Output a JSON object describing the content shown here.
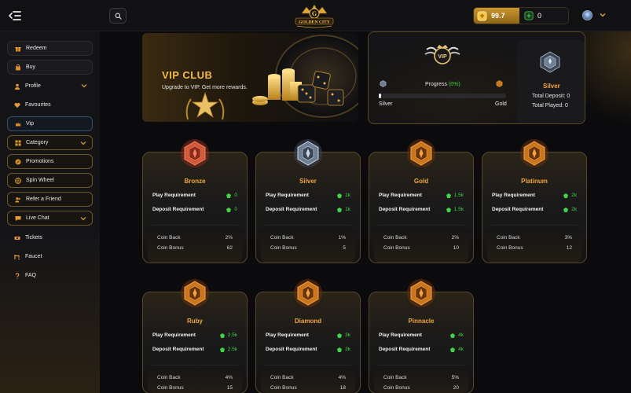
{
  "header": {
    "logo_text": "GOLDEN CITY",
    "wallet": {
      "gold_value": "99.7",
      "green_value": "0"
    },
    "icons": {
      "menu": "menu-arrow-icon",
      "search": "search-icon",
      "gold": "gold-coin-icon",
      "green": "green-coin-icon",
      "avatar": "avatar",
      "chevron": "chevron-down-icon"
    }
  },
  "sidebar": {
    "items": [
      {
        "label": "Redeem",
        "icon": "gift-icon"
      },
      {
        "label": "Buy",
        "icon": "shopping-bag-icon"
      },
      {
        "label": "Profile",
        "icon": "user-icon"
      },
      {
        "label": "Favourites",
        "icon": "heart-icon"
      },
      {
        "label": "Vip",
        "icon": "crown-icon"
      },
      {
        "label": "Category",
        "icon": "grid-icon"
      },
      {
        "label": "Promotions",
        "icon": "percent-icon"
      },
      {
        "label": "Spin Wheel",
        "icon": "wheel-icon"
      },
      {
        "label": "Refer a Friend",
        "icon": "users-icon"
      },
      {
        "label": "Live Chat",
        "icon": "chat-icon"
      },
      {
        "label": "Tickets",
        "icon": "ticket-icon"
      },
      {
        "label": "Faucet",
        "icon": "faucet-icon"
      },
      {
        "label": "FAQ",
        "icon": "question-icon"
      }
    ]
  },
  "banner": {
    "title": "VIP CLUB",
    "subtitle": "Upgrade to VIP. Get more rewards."
  },
  "progress": {
    "label": "Progress",
    "percent_text": "(0%)",
    "percent": 0.02,
    "from_level": "Silver",
    "to_level": "Gold",
    "current_tier": "Silver",
    "total_deposit": "Total Deposit:  0",
    "total_played": "Total Played:  0"
  },
  "colors": {
    "accent": "#f0a53a",
    "green": "#3fd447",
    "card_border": "#5a4628"
  },
  "labels": {
    "play_req": "Play Requirement",
    "deposit_req": "Deposit Requirement",
    "coin_back": "Coin Back",
    "coin_bonus": "Coin Bonus"
  },
  "tiers": [
    {
      "name": "Bronze",
      "play": "0",
      "deposit": "0",
      "coin_back": "2%",
      "coin_bonus": "62"
    },
    {
      "name": "Silver",
      "play": "1k",
      "deposit": "1k",
      "coin_back": "1%",
      "coin_bonus": "5"
    },
    {
      "name": "Gold",
      "play": "1.5k",
      "deposit": "1.5k",
      "coin_back": "2%",
      "coin_bonus": "10"
    },
    {
      "name": "Platinum",
      "play": "2k",
      "deposit": "2k",
      "coin_back": "3%",
      "coin_bonus": "12"
    },
    {
      "name": "Ruby",
      "play": "2.5k",
      "deposit": "2.5k",
      "coin_back": "4%",
      "coin_bonus": "15"
    },
    {
      "name": "Diamond",
      "play": "3k",
      "deposit": "3k",
      "coin_back": "4%",
      "coin_bonus": "18"
    },
    {
      "name": "Pinnacle",
      "play": "4k",
      "deposit": "4k",
      "coin_back": "5%",
      "coin_bonus": "20"
    }
  ]
}
